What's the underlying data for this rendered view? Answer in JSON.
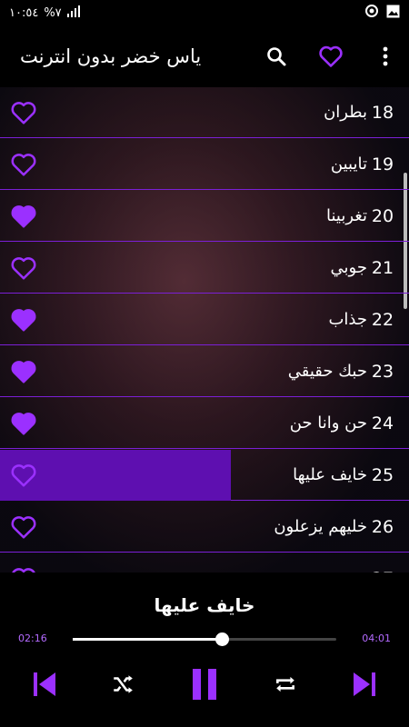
{
  "status_bar": {
    "time": "١٠:٥٤",
    "battery": "%٧"
  },
  "app_bar": {
    "title": "ياس خضر بدون انترنت"
  },
  "songs": [
    {
      "num": "18",
      "title": "بطران",
      "favorite": false
    },
    {
      "num": "19",
      "title": "تايبين",
      "favorite": false
    },
    {
      "num": "20",
      "title": "تغربينا",
      "favorite": true
    },
    {
      "num": "21",
      "title": "جوبي",
      "favorite": false
    },
    {
      "num": "22",
      "title": "جذاب",
      "favorite": true
    },
    {
      "num": "23",
      "title": "حبك حقيقي",
      "favorite": true
    },
    {
      "num": "24",
      "title": "حن وانا حن",
      "favorite": true
    },
    {
      "num": "25",
      "title": "خايف عليها",
      "favorite": false,
      "active": true
    },
    {
      "num": "26",
      "title": "خليهم يزعلون",
      "favorite": false
    },
    {
      "num": "27",
      "title": "",
      "favorite": false
    }
  ],
  "player": {
    "now_playing": "خايف عليها",
    "current_time": "02:16",
    "total_time": "04:01",
    "progress": 0.565
  },
  "colors": {
    "accent": "#9b30ff",
    "active_row": "#5e0fb0",
    "divider": "#7b1fd6"
  }
}
